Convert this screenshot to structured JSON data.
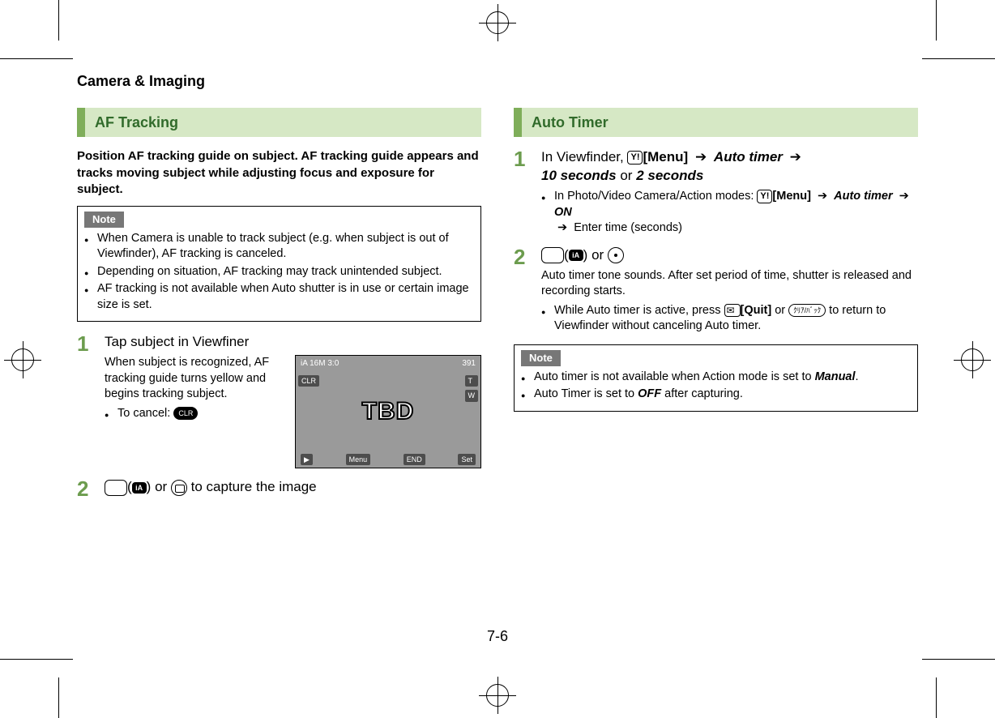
{
  "header": "Camera & Imaging",
  "page_number": "7-6",
  "left": {
    "section_title": "AF Tracking",
    "intro": "Position AF tracking guide on subject. AF tracking guide appears and tracks moving subject while adjusting focus and exposure for subject.",
    "note_label": "Note",
    "notes": [
      "When Camera is unable to track subject (e.g. when subject is out of Viewfinder), AF tracking is canceled.",
      "Depending on situation, AF tracking may track unintended subject.",
      "AF tracking is not available when Auto shutter is in use or certain image size is set."
    ],
    "step1_title": "Tap subject in Viewfiner",
    "step1_desc": "When subject is recognized, AF tracking guide turns yellow and begins tracking subject.",
    "step1_cancel": "To cancel: ",
    "step1_cancel_key": "CLR",
    "step2_tail": " to capture the image",
    "step2_or": " or ",
    "screenshot": {
      "tbd": "TBD",
      "topleft": "iA  16M  3:0",
      "topright": "391",
      "side_t": "T",
      "side_w": "W",
      "left_clr": "CLR",
      "bot_play": "▶",
      "bot_menu": "Menu",
      "bot_end": "END",
      "bot_set": "Set"
    }
  },
  "right": {
    "section_title": "Auto Timer",
    "step1_pre": "In Viewfinder, ",
    "step1_menu": "[Menu]",
    "step1_autotimer": "Auto timer",
    "step1_ten": "10 seconds",
    "step1_or": " or ",
    "step1_two": "2 seconds",
    "step1_sub_pre": "In Photo/Video Camera/Action modes: ",
    "step1_sub_on": "ON",
    "step1_sub_enter": " Enter time (seconds)",
    "step2_or": " or ",
    "step2_desc": "Auto timer tone sounds. After set period of time, shutter is released and recording starts.",
    "step2_sub_pre": "While Auto timer is active, press ",
    "step2_sub_quit": "[Quit]",
    "step2_sub_mid": " or ",
    "step2_sub_key2": "ｸﾘｱ/ﾊﾞｯｸ",
    "step2_sub_tail": " to return to Viewfinder without canceling Auto timer.",
    "note_label": "Note",
    "note1_pre": "Auto timer is not available when Action mode is set to ",
    "note1_manual": "Manual",
    "note1_post": ".",
    "note2_pre": "Auto Timer is set to ",
    "note2_off": "OFF",
    "note2_post": " after capturing."
  },
  "keys": {
    "yy": "Y!",
    "ia": "iA"
  }
}
